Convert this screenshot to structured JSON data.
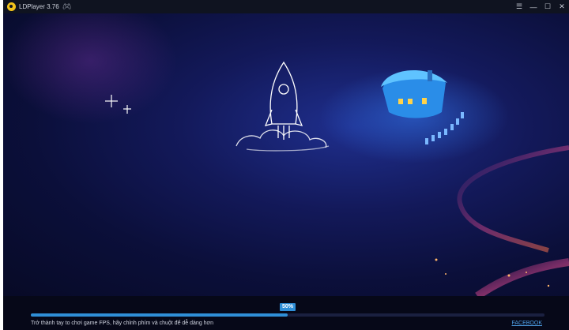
{
  "window": {
    "title": "LDPlayer 3.76"
  },
  "icons": {
    "app_logo": "ldplayer-logo-icon",
    "gamepad": "gamepad-icon",
    "menu": "hamburger-menu-icon",
    "minimize": "minimize-icon",
    "maximize": "maximize-icon",
    "close": "close-icon"
  },
  "controls": {
    "menu": "☰",
    "minimize": "—",
    "maximize": "☐",
    "close": "✕"
  },
  "loading": {
    "progress_percent": 50,
    "progress_label": "50%",
    "tip": "Trở thành tay to chơi game FPS, hãy chỉnh phím và chuột để dễ dàng hơn",
    "link_label": "FACEBOOK"
  },
  "colors": {
    "accent": "#2f8fd8",
    "background": "#0a0d2c",
    "house": "#4ab0ff"
  }
}
